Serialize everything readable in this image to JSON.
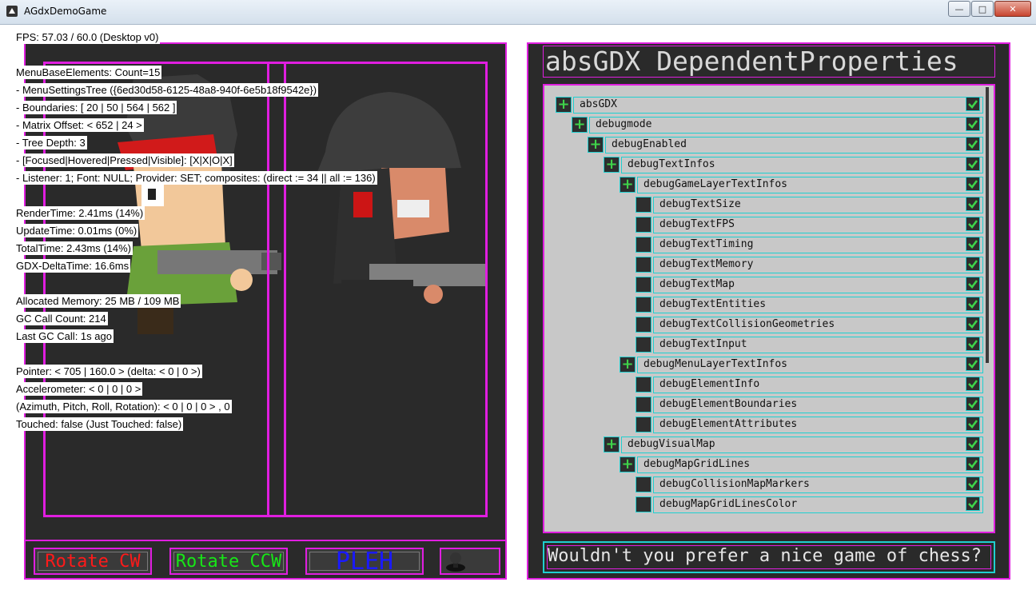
{
  "window": {
    "title": "AGdxDemoGame"
  },
  "debug_lines": [
    "FPS: 57.03 / 60.0 (Desktop v0)",
    "MenuBaseElements: Count=15",
    " - MenuSettingsTree ({6ed30d58-6125-48a8-940f-6e5b18f9542e})",
    " - Boundaries: [ 20 | 50 | 564 | 562 ]",
    " - Matrix Offset: < 652 | 24 >",
    " - Tree Depth: 3",
    " - [Focused|Hovered|Pressed|Visible]: [X|X|O|X]",
    " - Listener: 1; Font: NULL; Provider: SET; composites: (direct := 34 || all := 136)",
    "RenderTime: 2.41ms (14%)",
    "UpdateTime: 0.01ms (0%)",
    "TotalTime:  2.43ms (14%)",
    "GDX-DeltaTime:  16.6ms",
    "Allocated Memory:  25 MB / 109 MB",
    "GC Call Count: 214",
    "Last GC Call: 1s ago",
    "Pointer: < 705 | 160.0 > (delta: < 0 | 0 >)",
    "Accelerometer: < 0 | 0 | 0 >",
    "(Azimuth, Pitch, Roll, Rotation): < 0 | 0 | 0 > , 0",
    "Touched: false (Just Touched: false)"
  ],
  "buttons": {
    "rotate_cw": "Rotate CW",
    "rotate_ccw": "Rotate CCW",
    "help": "PLEH"
  },
  "panel": {
    "title": "absGDX DependentProperties"
  },
  "tree": [
    {
      "label": "absGDX",
      "depth": 0,
      "expandable": true,
      "checked": true
    },
    {
      "label": "debugmode",
      "depth": 1,
      "expandable": true,
      "checked": true
    },
    {
      "label": "debugEnabled",
      "depth": 2,
      "expandable": true,
      "checked": true
    },
    {
      "label": "debugTextInfos",
      "depth": 3,
      "expandable": true,
      "checked": true
    },
    {
      "label": "debugGameLayerTextInfos",
      "depth": 4,
      "expandable": true,
      "checked": true
    },
    {
      "label": "debugTextSize",
      "depth": 5,
      "expandable": false,
      "checked": true
    },
    {
      "label": "debugTextFPS",
      "depth": 5,
      "expandable": false,
      "checked": true
    },
    {
      "label": "debugTextTiming",
      "depth": 5,
      "expandable": false,
      "checked": true
    },
    {
      "label": "debugTextMemory",
      "depth": 5,
      "expandable": false,
      "checked": true
    },
    {
      "label": "debugTextMap",
      "depth": 5,
      "expandable": false,
      "checked": true
    },
    {
      "label": "debugTextEntities",
      "depth": 5,
      "expandable": false,
      "checked": true
    },
    {
      "label": "debugTextCollisionGeometries",
      "depth": 5,
      "expandable": false,
      "checked": true
    },
    {
      "label": "debugTextInput",
      "depth": 5,
      "expandable": false,
      "checked": true
    },
    {
      "label": "debugMenuLayerTextInfos",
      "depth": 4,
      "expandable": true,
      "checked": true
    },
    {
      "label": "debugElementInfo",
      "depth": 5,
      "expandable": false,
      "checked": true
    },
    {
      "label": "debugElementBoundaries",
      "depth": 5,
      "expandable": false,
      "checked": true
    },
    {
      "label": "debugElementAttributes",
      "depth": 5,
      "expandable": false,
      "checked": true
    },
    {
      "label": "debugVisualMap",
      "depth": 3,
      "expandable": true,
      "checked": true
    },
    {
      "label": "debugMapGridLines",
      "depth": 4,
      "expandable": true,
      "checked": true
    },
    {
      "label": "debugCollisionMapMarkers",
      "depth": 5,
      "expandable": false,
      "checked": true
    },
    {
      "label": "debugMapGridLinesColor",
      "depth": 5,
      "expandable": false,
      "checked": true
    }
  ],
  "chat_text": "Wouldn't you prefer a nice game of chess?",
  "colors": {
    "frame_magenta": "#e01ee0",
    "tree_border_cyan": "#1fd0d0",
    "check_green": "#3fd34a"
  }
}
